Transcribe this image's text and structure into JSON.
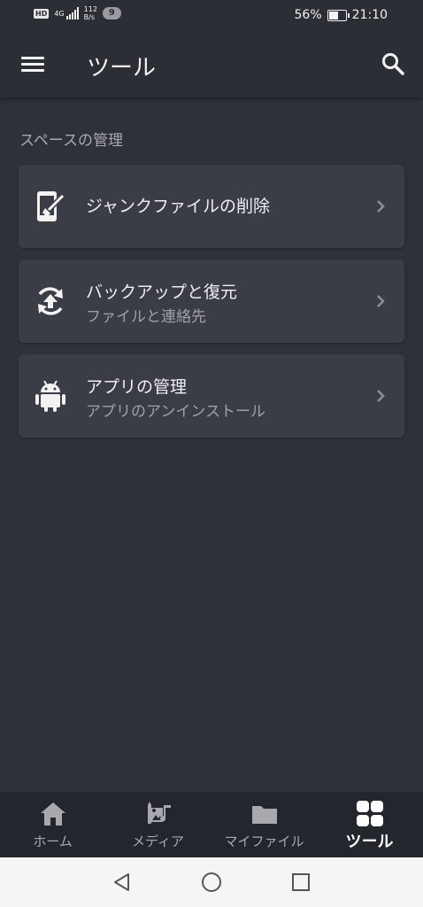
{
  "status_bar": {
    "hd": "HD",
    "network_type": "4G",
    "speed_value": "112",
    "speed_unit": "B/s",
    "notification_count": "9",
    "battery_percent": "56%",
    "battery_level": 0.56,
    "time": "21:10"
  },
  "app_bar": {
    "title": "ツール",
    "menu_icon": "hamburger-menu-icon",
    "search_icon": "search-icon"
  },
  "section": {
    "label": "スペースの管理"
  },
  "cards": [
    {
      "title": "ジャンクファイルの削除",
      "subtitle": "",
      "icon": "phone-broom-icon"
    },
    {
      "title": "バックアップと復元",
      "subtitle": "ファイルと連絡先",
      "icon": "backup-restore-icon"
    },
    {
      "title": "アプリの管理",
      "subtitle": "アプリのアンインストール",
      "icon": "android-icon"
    }
  ],
  "bottom_nav": {
    "items": [
      {
        "label": "ホーム",
        "icon": "home-icon",
        "active": false
      },
      {
        "label": "メディア",
        "icon": "media-icon",
        "active": false
      },
      {
        "label": "マイファイル",
        "icon": "folder-icon",
        "active": false
      },
      {
        "label": "ツール",
        "icon": "tools-grid-icon",
        "active": true
      }
    ]
  },
  "system_nav": {
    "icons": [
      "back-icon",
      "home-circle-icon",
      "recents-icon"
    ]
  },
  "colors": {
    "background": "#2e3138",
    "card": "#3a3d45",
    "bottom_nav": "#23262c",
    "active": "#ffffff",
    "inactive": "#a7a9ae"
  }
}
